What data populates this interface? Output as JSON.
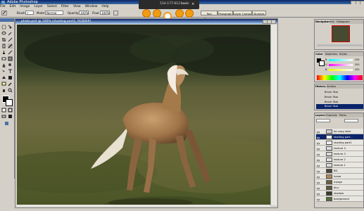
{
  "app": {
    "title": "Adobe Photoshop"
  },
  "menu": [
    "File",
    "Edit",
    "Image",
    "Layer",
    "Select",
    "Filter",
    "View",
    "Window",
    "Help"
  ],
  "options_bar": {
    "tool_label": "Brush:",
    "mode_label": "Mode:",
    "mode_value": "Normal",
    "opacity_label": "Opacity:",
    "opacity_value": "100%",
    "flow_label": "Flow:",
    "flow_value": "100%",
    "tabs": [
      "Tool Presets",
      "Paragraph",
      "Layer Comps",
      "Brushes"
    ]
  },
  "floating_bar": {
    "caption": "514-177-612",
    "mode": "basic"
  },
  "document": {
    "title": "photo.psd @ 100% (shading part2, RGB/8#)"
  },
  "panels": {
    "navigator": {
      "tabs": [
        "Navigator",
        "Info",
        "Histogram"
      ]
    },
    "color": {
      "tabs": [
        "Color",
        "Swatches",
        "Styles"
      ],
      "channels": [
        {
          "name": "R",
          "value": "255"
        },
        {
          "name": "G",
          "value": "255"
        },
        {
          "name": "B",
          "value": "255"
        }
      ]
    },
    "history": {
      "tabs": [
        "History",
        "Actions"
      ],
      "items": [
        "Brush Tool",
        "Brush Tool",
        "Brush Tool",
        "Brush Tool"
      ],
      "selected_index": 3
    },
    "layers": {
      "tabs": [
        "Layers",
        "Channels",
        "Paths"
      ],
      "items": [
        {
          "name": "for easy later",
          "thumb": "#cfcfcf"
        },
        {
          "name": "shading part...",
          "thumb": "#f0f0f0",
          "selected": true
        },
        {
          "name": "shading part1",
          "thumb": "#efefef"
        },
        {
          "name": "texture 4",
          "thumb": "#dedede"
        },
        {
          "name": "texture 3",
          "thumb": "#d8d8d8"
        },
        {
          "name": "texture 2",
          "thumb": "#e2e2e2"
        },
        {
          "name": "texture 1",
          "thumb": "#dcdcdc"
        },
        {
          "name": "BG",
          "thumb": "#4a4236"
        },
        {
          "name": "horse",
          "thumb": "#b08a5a"
        },
        {
          "name": "merge",
          "thumb": "#6b6040"
        },
        {
          "name": "blur",
          "thumb": "#5f5a3a"
        },
        {
          "name": "shadow",
          "thumb": "#3a3a2a"
        },
        {
          "name": "background",
          "thumb": "#556b3a"
        }
      ]
    }
  },
  "colors": {
    "accent": "#f39c12",
    "title_blue": "#0a246a",
    "ui_gray": "#d4d0c8"
  }
}
